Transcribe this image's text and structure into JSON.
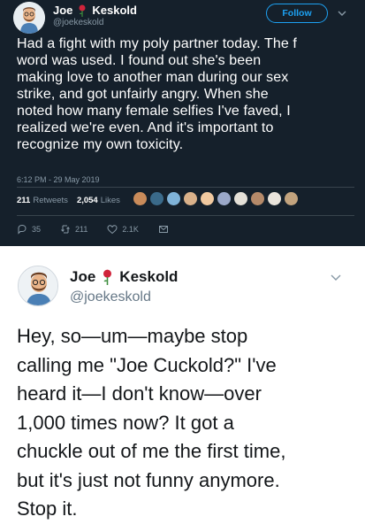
{
  "first_tweet": {
    "author": {
      "first_name": "Joe",
      "last_name": "Keskold",
      "handle": "@joekeskold"
    },
    "follow_label": "Follow",
    "text_lines": [
      "Had a fight with my poly partner today. The f",
      "word was used. I found out she's been",
      "making love to another man during our sex",
      "strike, and got unfairly angry. When she",
      "noted how many female selfies I've faved, I",
      "realized we're even. And it's important to",
      "recognize my own toxicity."
    ],
    "timestamp": "6:12 PM - 29 May 2019",
    "retweets_count": "211",
    "retweets_label": "Retweets",
    "likes_count": "2,054",
    "likes_label": "Likes",
    "actions": {
      "reply_count": "35",
      "retweet_count": "211",
      "like_count": "2.1K"
    },
    "colors": {
      "background": "#15202b",
      "accent": "#1da1f2",
      "muted": "#8899a6"
    }
  },
  "second_tweet": {
    "author": {
      "first_name": "Joe",
      "last_name": "Keskold",
      "handle": "@joekeskold"
    },
    "text_lines": [
      "Hey, so—um—maybe stop",
      "calling me \"Joe Cuckold?\" I've",
      "heard it—I don't know—over",
      "1,000 times now? It got a",
      "chuckle out of me the first time,",
      "but it's just not funny anymore.",
      "Stop it."
    ]
  }
}
